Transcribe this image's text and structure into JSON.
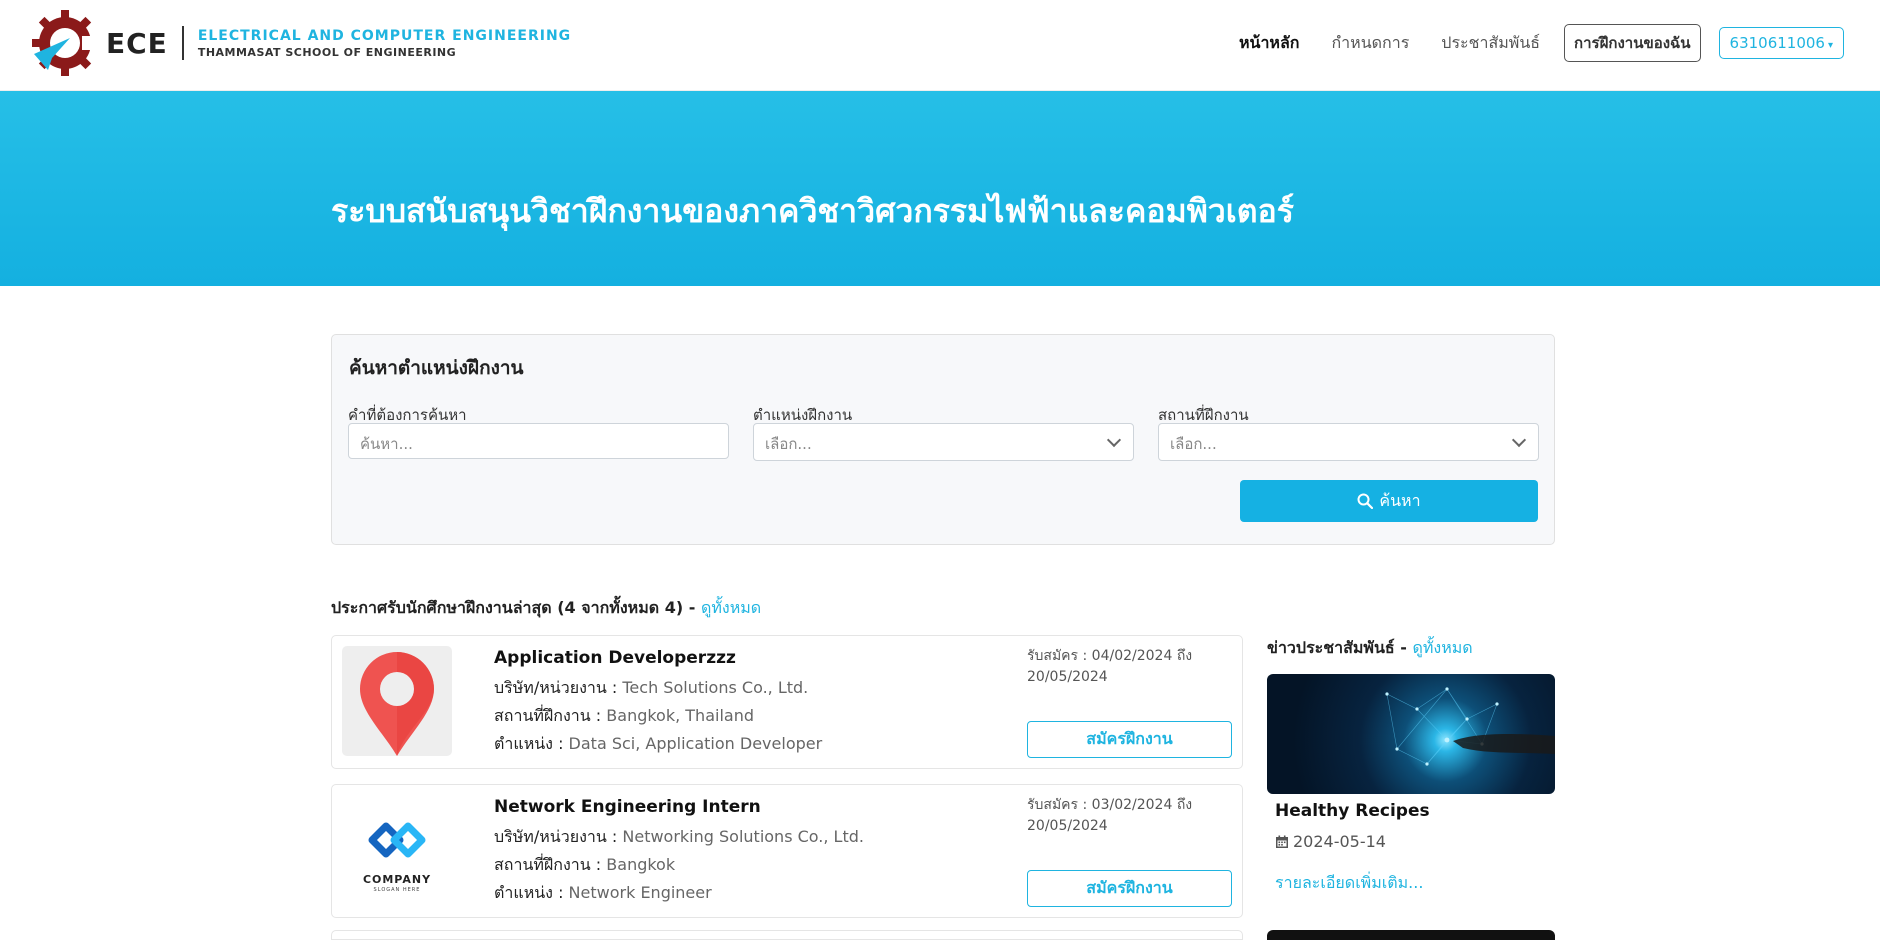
{
  "brand": {
    "short": "ECE",
    "line1": "ELECTRICAL AND COMPUTER ENGINEERING",
    "line2": "THAMMASAT SCHOOL OF ENGINEERING",
    "colors": {
      "accent": "#1fb4e0",
      "gear": "#8b1a1a"
    }
  },
  "nav": {
    "home": "หน้าหลัก",
    "schedule": "กำหนดการ",
    "announcements": "ประชาสัมพันธ์",
    "my_internship": "การฝึกงานของฉัน",
    "user": "6310611006"
  },
  "hero": {
    "title": "ระบบสนับสนุนวิชาฝึกงานของภาควิชาวิศวกรรมไฟฟ้าและคอมพิวเตอร์"
  },
  "search": {
    "heading": "ค้นหาตำแหน่งฝึกงาน",
    "keyword_label": "คำที่ต้องการค้นหา",
    "keyword_placeholder": "ค้นหา...",
    "position_label": "ตำแหน่งฝึกงาน",
    "position_value": "เลือก...",
    "location_label": "สถานที่ฝึกงาน",
    "location_value": "เลือก...",
    "button": "ค้นหา"
  },
  "listing": {
    "heading": "ประกาศรับนักศึกษาฝึกงานล่าสุด (4 จากทั้งหมด 4) - ",
    "see_all": "ดูทั้งหมด",
    "company_label": "บริษัท/หน่วยงาน : ",
    "location_label": "สถานที่ฝึกงาน : ",
    "position_label": "ตำแหน่ง : ",
    "apply": "สมัครฝึกงาน",
    "jobs": [
      {
        "title": "Application Developerzzz",
        "company": "Tech Solutions Co., Ltd.",
        "location": "Bangkok, Thailand",
        "positions": "Data Sci, Application Developer",
        "dates": "รับสมัคร : 04/02/2024 ถึง 20/05/2024",
        "logo": "map-pin-icon"
      },
      {
        "title": "Network Engineering Intern",
        "company": "Networking Solutions Co., Ltd.",
        "location": "Bangkok",
        "positions": "Network Engineer",
        "dates": "รับสมัคร : 03/02/2024 ถึง 20/05/2024",
        "logo": "company-logo",
        "logo_text": "COMPANY",
        "logo_slogan": "SLOGAN HERE"
      }
    ]
  },
  "news": {
    "heading": "ข่าวประชาสัมพันธ์ - ",
    "see_all": "ดูทั้งหมด",
    "items": [
      {
        "title": "Healthy Recipes",
        "date": "2024-05-14",
        "more": "รายละเอียดเพิ่มเติม..."
      }
    ]
  }
}
